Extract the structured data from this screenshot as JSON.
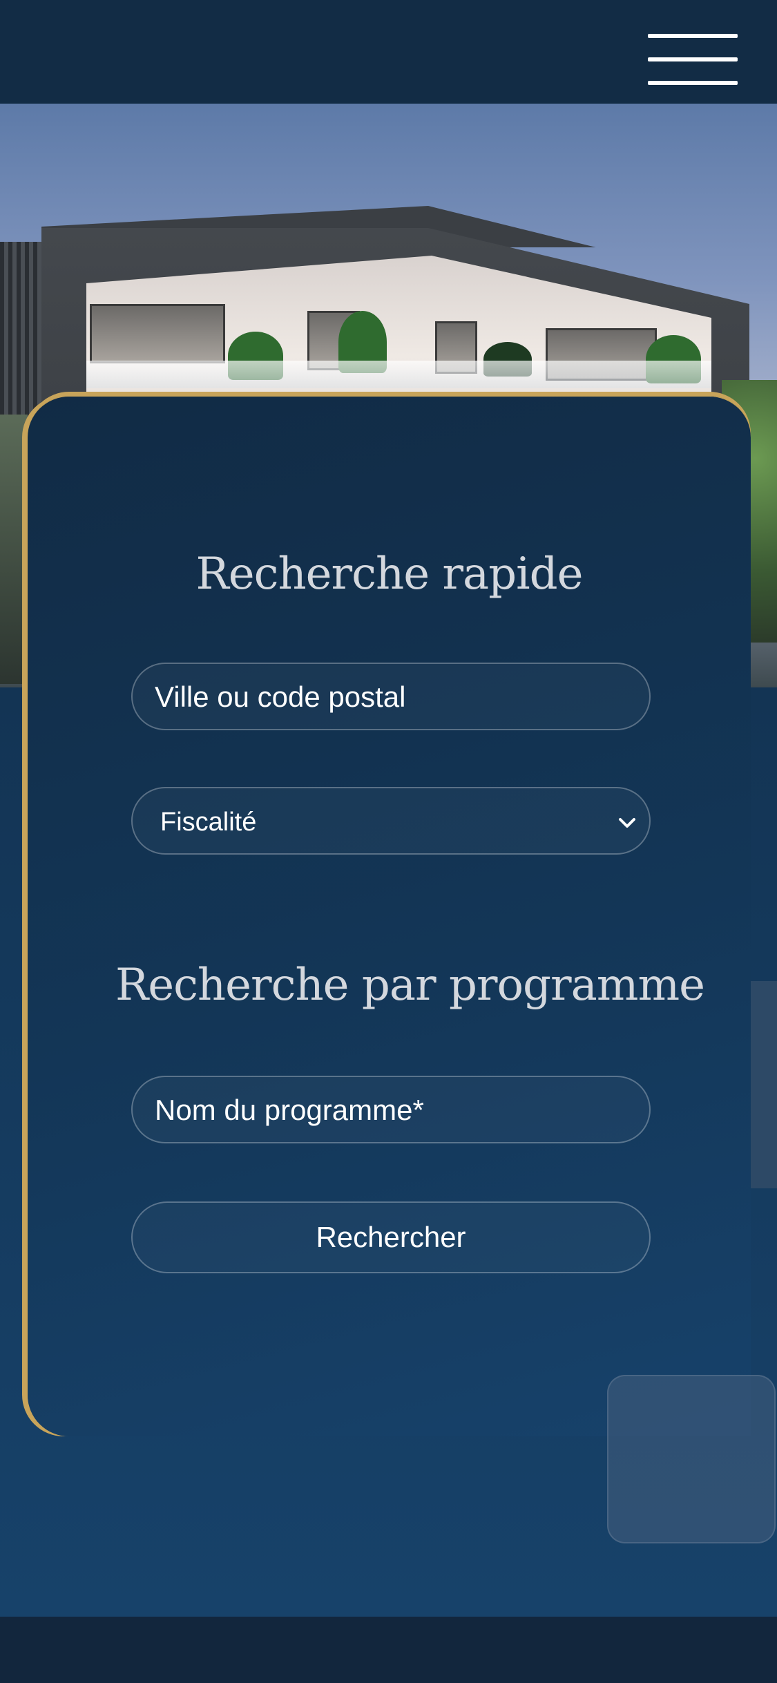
{
  "header": {
    "menu_icon": "hamburger-menu-icon"
  },
  "hero": {
    "image_alt": "Résidence moderne"
  },
  "search": {
    "quick_title": "Recherche rapide",
    "city_placeholder": "Ville ou code postal",
    "tax_select": {
      "selected": "Fiscalité",
      "icon": "chevron-down-icon"
    },
    "program_title": "Recherche par programme",
    "program_placeholder": "Nom du programme*",
    "submit_label": "Rechercher"
  },
  "colors": {
    "navy": "#122c45",
    "gold": "#c8a45a",
    "card": "#133657"
  }
}
